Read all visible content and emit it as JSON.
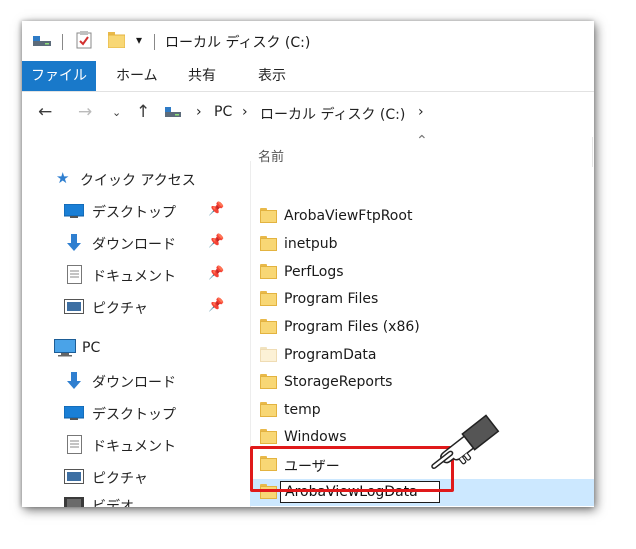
{
  "window": {
    "title": "ローカル ディスク (C:)",
    "quick_access_dropdown": "▾"
  },
  "ribbon": {
    "tabs": [
      {
        "label": "ファイル",
        "active": true
      },
      {
        "label": "ホーム"
      },
      {
        "label": "共有"
      },
      {
        "label": "表示"
      }
    ],
    "accent_color": "#1979ca"
  },
  "address_bar": {
    "back_icon": "arrow-left-icon",
    "breadcrumbs": [
      "PC",
      "ローカル ディスク (C:)"
    ],
    "separator": "›"
  },
  "nav_pane": {
    "quick_access": {
      "label": "クイック アクセス",
      "items": [
        {
          "label": "デスクトップ",
          "icon": "desktop-icon",
          "pinned": true
        },
        {
          "label": "ダウンロード",
          "icon": "download-icon",
          "pinned": true
        },
        {
          "label": "ドキュメント",
          "icon": "document-icon",
          "pinned": true
        },
        {
          "label": "ピクチャ",
          "icon": "pictures-icon",
          "pinned": true
        }
      ]
    },
    "pc": {
      "label": "PC",
      "items": [
        {
          "label": "ダウンロード",
          "icon": "download-icon"
        },
        {
          "label": "デスクトップ",
          "icon": "desktop-icon"
        },
        {
          "label": "ドキュメント",
          "icon": "document-icon"
        },
        {
          "label": "ピクチャ",
          "icon": "pictures-icon"
        },
        {
          "label": "ビデオ",
          "icon": "video-icon"
        }
      ]
    }
  },
  "file_list": {
    "column_name": "名前",
    "items": [
      {
        "name": "ArobaViewFtpRoot"
      },
      {
        "name": "inetpub"
      },
      {
        "name": "PerfLogs"
      },
      {
        "name": "Program Files"
      },
      {
        "name": "Program Files (x86)"
      },
      {
        "name": "ProgramData",
        "hidden": true
      },
      {
        "name": "StorageReports"
      },
      {
        "name": "temp"
      },
      {
        "name": "Windows"
      },
      {
        "name": "ユーザー"
      }
    ],
    "renaming": {
      "value": "ArobaViewLogData"
    }
  },
  "annotation": {
    "highlight_color": "#e0191a"
  }
}
